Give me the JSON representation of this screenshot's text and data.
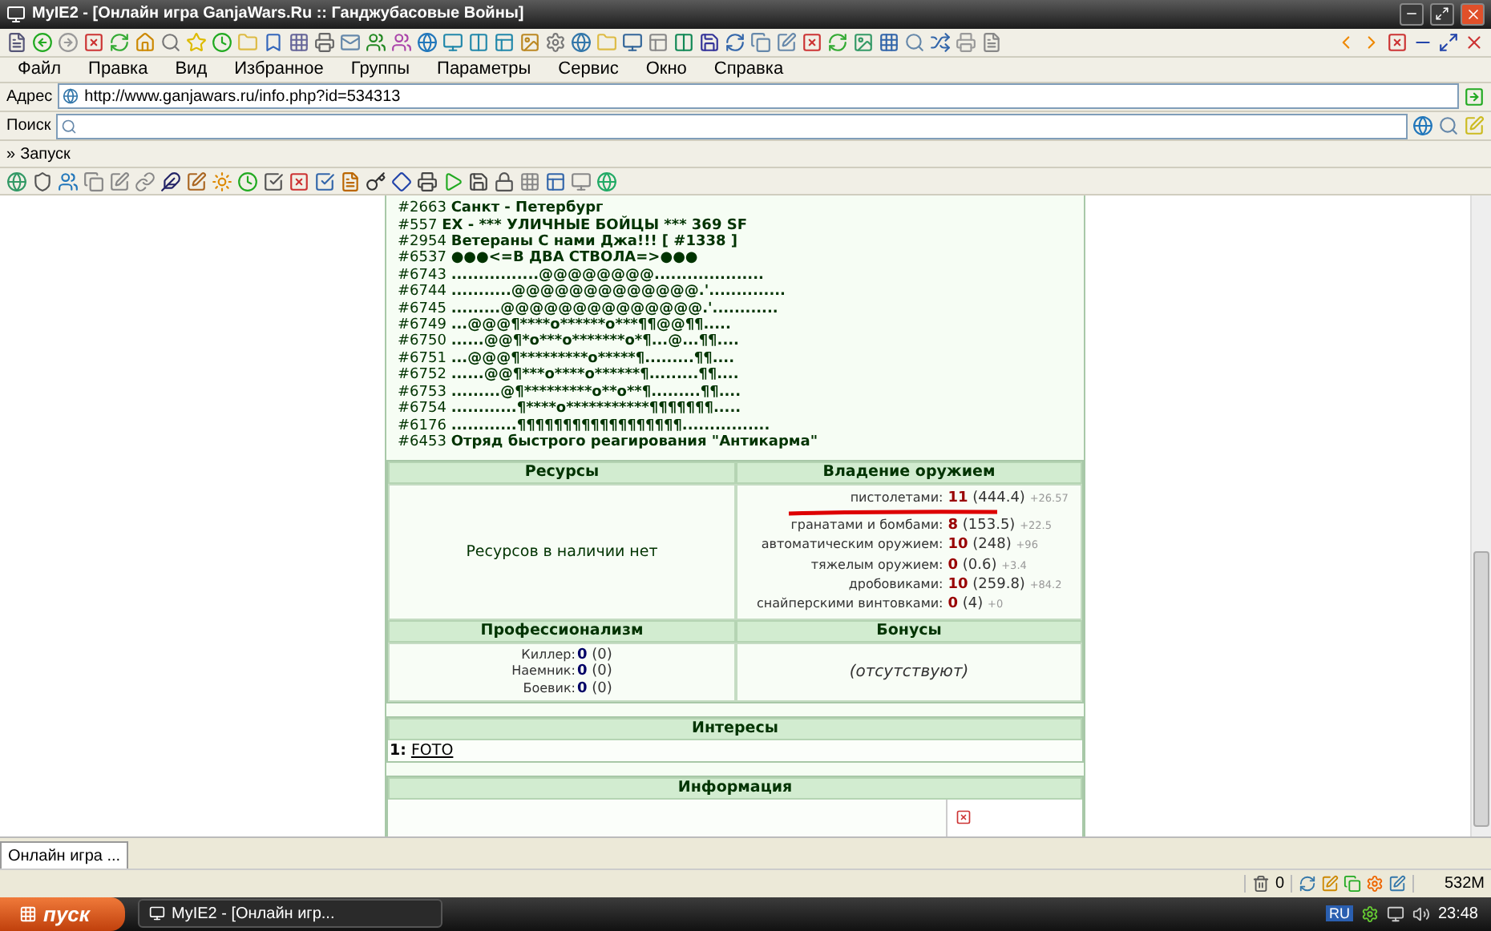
{
  "window": {
    "title": "MyIE2 - [Онлайн игра GanjaWars.Ru :: Ганджубасовые Войны]"
  },
  "menu": [
    "Файл",
    "Правка",
    "Вид",
    "Избранное",
    "Группы",
    "Параметры",
    "Сервис",
    "Окно",
    "Справка"
  ],
  "address": {
    "label": "Адрес",
    "value": "http://www.ganjawars.ru/info.php?id=534313"
  },
  "search": {
    "label": "Поиск"
  },
  "links_bar": {
    "chevron": "»",
    "label": "Запуск"
  },
  "guilds": [
    {
      "number": "#2663",
      "name": "Санкт - Петербург"
    },
    {
      "number": "#557",
      "name": "EX - *** УЛИЧНЫЕ БОЙЦЫ *** 369 SF"
    },
    {
      "number": "#2954",
      "name": "Ветераны С нами Джа!!! [ #1338 ]"
    },
    {
      "number": "#6537",
      "name": "●●●<=В ДВА СТВОЛА=>●●●"
    },
    {
      "number": "#6743",
      "name": "................@@@@@@@@...................."
    },
    {
      "number": "#6744",
      "name": "...........@@@@@@@@@@@@@.'.............."
    },
    {
      "number": "#6745",
      "name": ".........@@@@@@@@@@@@@@.'............"
    },
    {
      "number": "#6749",
      "name": "...@@@¶****o******o***¶¶@@¶¶....."
    },
    {
      "number": "#6750",
      "name": "......@@¶*o***o*******o*¶...@...¶¶...."
    },
    {
      "number": "#6751",
      "name": "...@@@¶*********o*****¶.........¶¶...."
    },
    {
      "number": "#6752",
      "name": "......@@¶***o****o******¶.........¶¶...."
    },
    {
      "number": "#6753",
      "name": ".........@¶*********o**o**¶.........¶¶...."
    },
    {
      "number": "#6754",
      "name": "............¶****o***********¶¶¶¶¶¶¶....."
    },
    {
      "number": "#6176",
      "name": "............¶¶¶¶¶¶¶¶¶¶¶¶¶¶¶¶¶¶................"
    },
    {
      "number": "#6453",
      "name": "Отряд быстрого реагирования \"Антикарма\""
    }
  ],
  "resources": {
    "header": "Ресурсы",
    "text": "Ресурсов в наличии нет"
  },
  "weapons": {
    "header": "Владение оружием",
    "rows": [
      {
        "label": "пистолетами:",
        "level": "11",
        "exp": "(444.4)",
        "gain": "+26.57",
        "underlined": true
      },
      {
        "label": "гранатами и бомбами:",
        "level": "8",
        "exp": "(153.5)",
        "gain": "+22.5",
        "underlined": false
      },
      {
        "label": "автоматическим оружием:",
        "level": "10",
        "exp": "(248)",
        "gain": "+96",
        "underlined": false
      },
      {
        "label": "тяжелым оружием:",
        "level": "0",
        "exp": "(0.6)",
        "gain": "+3.4",
        "underlined": false
      },
      {
        "label": "дробовиками:",
        "level": "10",
        "exp": "(259.8)",
        "gain": "+84.2",
        "underlined": false
      },
      {
        "label": "снайперскими винтовками:",
        "level": "0",
        "exp": "(4)",
        "gain": "+0",
        "underlined": false
      }
    ]
  },
  "professionalism": {
    "header": "Профессионализм",
    "rows": [
      {
        "label": "Киллер:",
        "level": "0",
        "exp": "(0)"
      },
      {
        "label": "Наемник:",
        "level": "0",
        "exp": "(0)"
      },
      {
        "label": "Боевик:",
        "level": "0",
        "exp": "(0)"
      }
    ]
  },
  "bonuses": {
    "header": "Бонусы",
    "text": "(отсутствуют)"
  },
  "interests": {
    "header": "Интересы",
    "items": [
      {
        "number": "1:",
        "link": "FOTO"
      }
    ]
  },
  "information": {
    "header": "Информация"
  },
  "page_tabs": [
    {
      "label": "Онлайн игра ...",
      "selected": true
    }
  ],
  "status_bar": {
    "trash_count": "0",
    "memory": "532M"
  },
  "taskbar": {
    "start": "пуск",
    "tasks": [
      {
        "label": "MyIE2 - [Онлайн игр...",
        "selected": false
      }
    ],
    "language": "RU",
    "clock": "23:48"
  }
}
